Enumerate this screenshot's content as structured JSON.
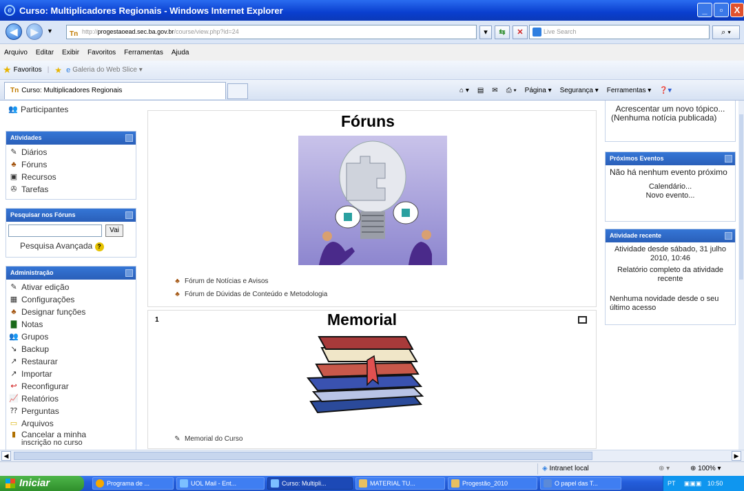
{
  "window": {
    "title": "Curso: Multiplicadores Regionais - Windows Internet Explorer",
    "minimize": "_",
    "maximize": "▫",
    "close": "X"
  },
  "address": {
    "prefix": "http://",
    "host": "progestaoead.sec.ba.gov.br",
    "path": "/course/view.php?id=24"
  },
  "search": {
    "placeholder": "Live Search"
  },
  "menu": [
    "Arquivo",
    "Editar",
    "Exibir",
    "Favoritos",
    "Ferramentas",
    "Ajuda"
  ],
  "favbar": {
    "favoritos": "Favoritos",
    "webslice": "Galeria do Web Slice ▾"
  },
  "tab": {
    "label": "Curso: Multiplicadores Regionais"
  },
  "cmdbar": {
    "pagina": "Página ▾",
    "seguranca": "Segurança ▾",
    "ferramentas": "Ferramentas ▾"
  },
  "left": {
    "participantes": "Participantes",
    "atividades": {
      "title": "Atividades",
      "items": [
        "Diários",
        "Fóruns",
        "Recursos",
        "Tarefas"
      ]
    },
    "pesquisar": {
      "title": "Pesquisar nos Fóruns",
      "button": "Vai",
      "advanced": "Pesquisa Avançada"
    },
    "admin": {
      "title": "Administração",
      "items": [
        "Ativar edição",
        "Configurações",
        "Designar funções",
        "Notas",
        "Grupos",
        "Backup",
        "Restaurar",
        "Importar",
        "Reconfigurar",
        "Relatórios",
        "Perguntas",
        "Arquivos",
        "Cancelar a minha",
        "inscrição no curso"
      ]
    }
  },
  "main": {
    "section0": {
      "title": "Fóruns",
      "links": [
        "Fórum de Notícias e Avisos",
        "Fórum de Dúvidas de Conteúdo e Metodologia"
      ]
    },
    "section1": {
      "number": "1",
      "title": "Memorial",
      "links": [
        "Memorial do Curso"
      ]
    }
  },
  "right": {
    "news": {
      "add": "Acrescentar um novo tópico...",
      "none": "(Nenhuma notícia publicada)"
    },
    "events": {
      "title": "Próximos Eventos",
      "none": "Não há nenhum evento próximo",
      "calendar": "Calendário...",
      "new": "Novo evento..."
    },
    "recent": {
      "title": "Atividade recente",
      "since": "Atividade desde sábado, 31 julho 2010, 10:46",
      "report": "Relatório completo da atividade recente",
      "nothing": "Nenhuma novidade desde o seu último acesso"
    }
  },
  "status": {
    "zone": "Intranet local",
    "zoom": "100%"
  },
  "taskbar": {
    "start": "Iniciar",
    "items": [
      "Programa de ...",
      "UOL Mail - Ent...",
      "Curso: Multipli...",
      "MATERIAL TU...",
      "Progestão_2010",
      "O papel das T..."
    ],
    "lang": "PT",
    "clock": "10:50"
  },
  "colors": {
    "accent": "#2a5fb9",
    "titlebar": "#0a3fcf",
    "taskbar": "#245edb",
    "start": "#2f8f2b"
  }
}
